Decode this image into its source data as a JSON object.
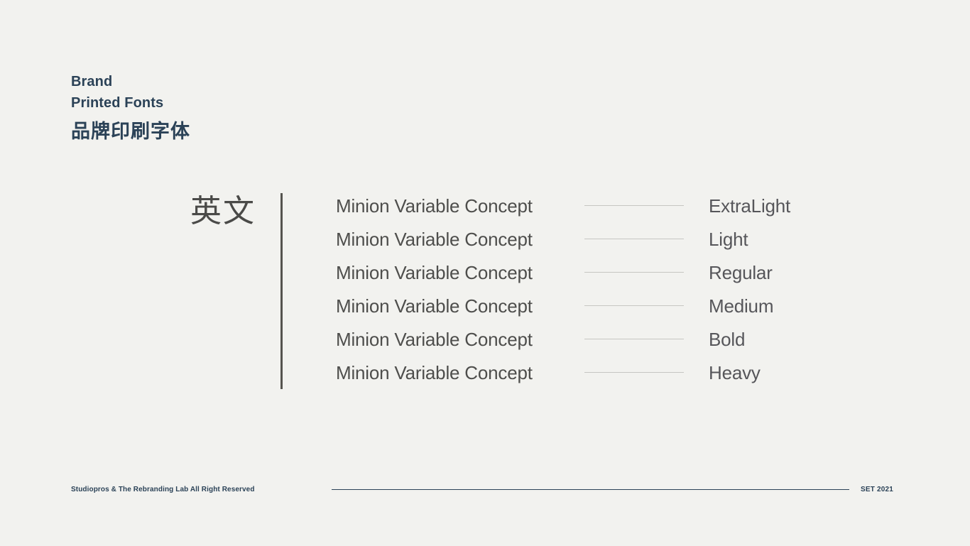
{
  "colors": {
    "background": "#f2f2ef",
    "brand_blue": "#2b4257",
    "sample_gray": "#4e4e4c",
    "label_gray": "#56565a",
    "cjk_gray": "#4a4a48",
    "divider_bar": "#55544f",
    "connector_line": "#c6c6c2",
    "footer_rule": "#2b4257"
  },
  "header": {
    "line1": "Brand",
    "line2": "Printed Fonts",
    "cjk": "品牌印刷字体"
  },
  "specimen": {
    "section_label": "英文",
    "rows": [
      {
        "sample": "Minion Variable Concept",
        "weight": "ExtraLight"
      },
      {
        "sample": "Minion Variable Concept",
        "weight": "Light"
      },
      {
        "sample": "Minion Variable Concept",
        "weight": "Regular"
      },
      {
        "sample": "Minion Variable Concept",
        "weight": "Medium"
      },
      {
        "sample": "Minion Variable Concept",
        "weight": "Bold"
      },
      {
        "sample": "Minion Variable Concept",
        "weight": "Heavy"
      }
    ]
  },
  "footer": {
    "credit": "Studiopros & The Rebranding Lab All Right Reserved",
    "set": "SET 2021"
  }
}
